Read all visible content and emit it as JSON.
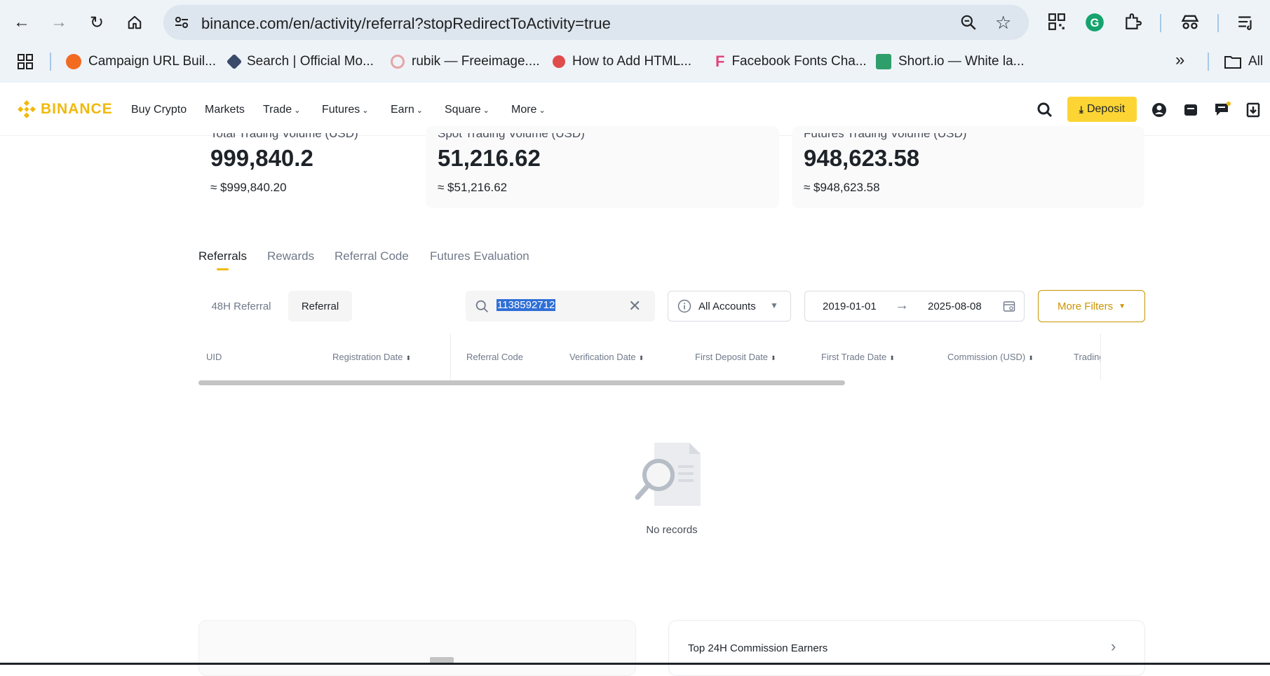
{
  "browser": {
    "url": "binance.com/en/activity/referral?stopRedirectToActivity=true",
    "bookmarks": [
      {
        "label": "Campaign URL Buil...",
        "color": "#f26b21"
      },
      {
        "label": "Search | Official Mo...",
        "color": "#3a4a6b"
      },
      {
        "label": "rubik — Freeimage....",
        "color": "#e6a5a5"
      },
      {
        "label": "How to Add HTML...",
        "color": "#e04b4b"
      },
      {
        "label": "Facebook Fonts Cha...",
        "color": "#e0457b"
      },
      {
        "label": "Short.io — White la...",
        "color": "#2e9e6b"
      }
    ],
    "all_bookmarks_label": "All"
  },
  "header": {
    "logo": "BINANCE",
    "menu": {
      "buy_crypto": "Buy Crypto",
      "markets": "Markets",
      "trade": "Trade",
      "futures": "Futures",
      "earn": "Earn",
      "square": "Square",
      "more": "More"
    },
    "deposit": "Deposit"
  },
  "stats": {
    "total": {
      "label": "Total Trading Volume (USD)",
      "value": "999,840.2",
      "usd": "≈ $999,840.20"
    },
    "spot": {
      "label": "Spot Trading Volume (USD)",
      "value": "51,216.62",
      "usd": "≈ $51,216.62"
    },
    "futures": {
      "label": "Futures Trading Volume (USD)",
      "value": "948,623.58",
      "usd": "≈ $948,623.58"
    }
  },
  "tabs": {
    "referrals": "Referrals",
    "rewards": "Rewards",
    "referral_code": "Referral Code",
    "futures_evaluation": "Futures Evaluation"
  },
  "filters": {
    "h48": "48H Referral",
    "referral": "Referral",
    "search_value": "1138592712",
    "accounts": "All Accounts",
    "date_from": "2019-01-01",
    "date_to": "2025-08-08",
    "more_filters": "More Filters"
  },
  "table": {
    "uid": "UID",
    "registration_date": "Registration Date",
    "referral_code": "Referral Code",
    "verification_date": "Verification Date",
    "first_deposit_date": "First Deposit Date",
    "first_trade_date": "First Trade Date",
    "commission": "Commission (USD)",
    "trading": "Trading"
  },
  "empty": "No records",
  "bottom": {
    "top24h": "Top 24H Commission Earners"
  },
  "colors": {
    "brand": "#f0b90b",
    "highlight": "#2f6fd6"
  }
}
